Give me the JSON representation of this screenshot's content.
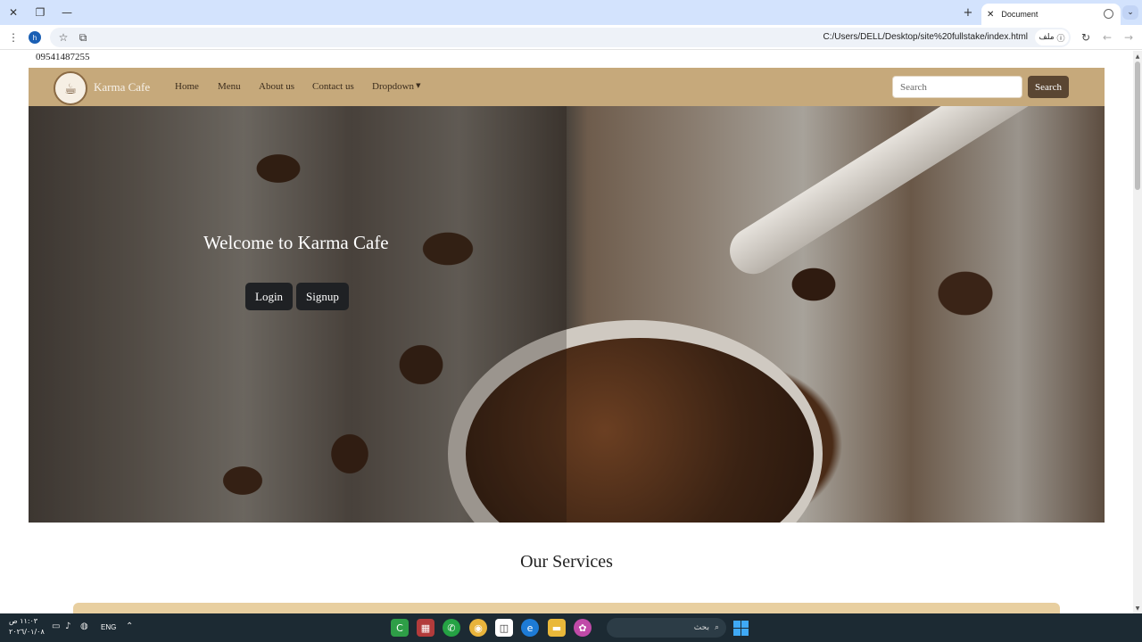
{
  "browser": {
    "tab_title": "Document",
    "address": "C:/Users/DELL/Desktop/site%20fullstake/index.html",
    "site_chip_label": "ملف",
    "profile_initial": "h"
  },
  "page": {
    "phone": "09541487255",
    "navbar": {
      "brand": "Karma Cafe",
      "links": [
        "Home",
        "Menu",
        "About us",
        "Contact us",
        "Dropdown"
      ],
      "search_placeholder": "Search",
      "search_button": "Search"
    },
    "hero": {
      "title": "Welcome to Karma Cafe",
      "login_label": "Login",
      "signup_label": "Signup"
    },
    "services": {
      "title": "Our Services"
    }
  },
  "taskbar": {
    "time": "١١:٠٣ ص",
    "date": "٢٠٢٦/٠١/٠٨",
    "language": "ENG",
    "search_label": "بحث"
  },
  "colors": {
    "navbar": "#c6a97b",
    "search_button": "#5a4632",
    "hero_button": "#1f2124",
    "services_card": "#e8cfa0"
  }
}
